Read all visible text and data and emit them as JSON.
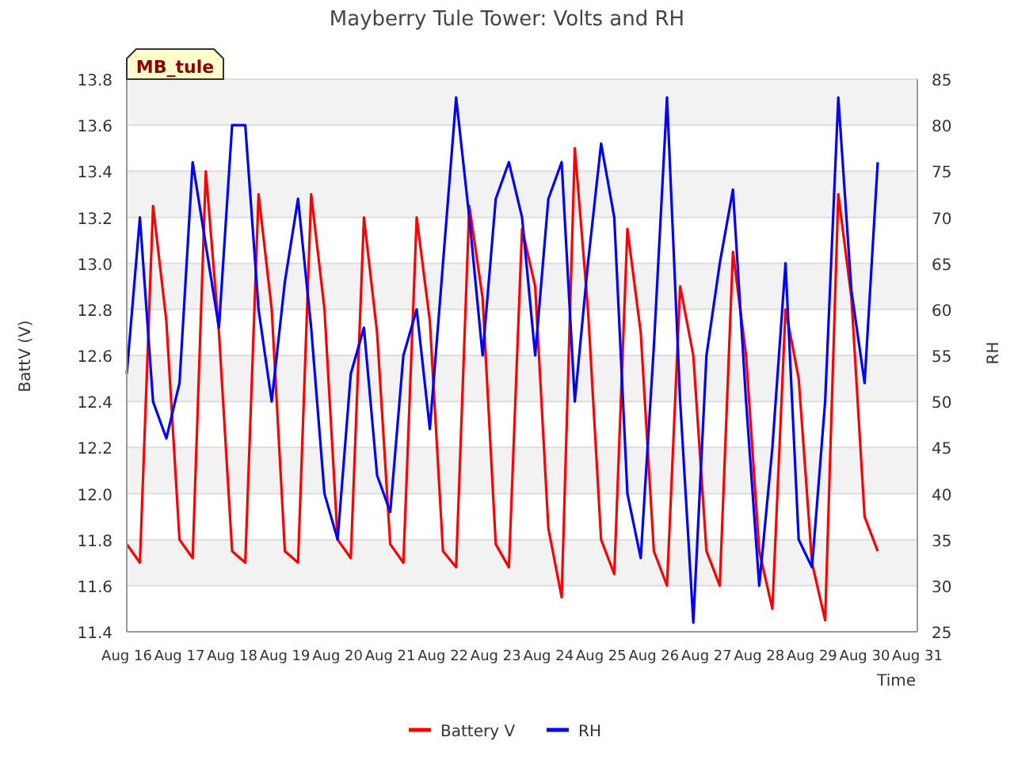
{
  "chart": {
    "tag": "MB_tule",
    "chart_data": {
      "type": "line",
      "title": "Mayberry Tule Tower: Volts and RH",
      "xlabel": "Time",
      "ylabel": "BattV (V)",
      "y2label": "RH",
      "ylim": [
        11.4,
        13.8
      ],
      "y2lim": [
        25,
        85
      ],
      "grid": true,
      "legend": "bottom",
      "yticks": [
        11.4,
        11.6,
        11.8,
        {
          "value": 12,
          "label": "12.0"
        },
        12.2,
        12.4,
        12.6,
        12.8,
        {
          "value": 13,
          "label": "13.0"
        },
        13.2,
        13.4,
        13.6,
        13.8
      ],
      "y2ticks": [
        25,
        30,
        35,
        40,
        45,
        50,
        55,
        60,
        65,
        70,
        75,
        80,
        85
      ],
      "categories": [
        "Aug 16",
        null,
        null,
        null,
        "Aug 17",
        null,
        null,
        null,
        "Aug 18",
        null,
        null,
        null,
        "Aug 19",
        null,
        null,
        null,
        "Aug 20",
        null,
        null,
        null,
        "Aug 21",
        null,
        null,
        null,
        "Aug 22",
        null,
        null,
        null,
        "Aug 23",
        null,
        null,
        null,
        "Aug 24",
        null,
        null,
        null,
        "Aug 25",
        null,
        null,
        null,
        "Aug 26",
        null,
        null,
        null,
        "Aug 27",
        null,
        null,
        null,
        "Aug 28",
        null,
        null,
        null,
        "Aug 29",
        null,
        null,
        null,
        "Aug 30",
        null,
        null,
        null,
        "Aug 31"
      ],
      "series": [
        {
          "name": "Battery V",
          "color": "#ff0000",
          "values": [
            11.78,
            11.7,
            13.25,
            12.75,
            11.8,
            11.72,
            13.4,
            12.7,
            11.75,
            11.7,
            13.3,
            12.8,
            11.75,
            11.7,
            13.3,
            12.8,
            11.8,
            11.72,
            13.2,
            12.7,
            11.78,
            11.7,
            13.2,
            12.75,
            11.75,
            11.68,
            13.25,
            12.85,
            11.78,
            11.68,
            13.15,
            12.9,
            11.85,
            11.55,
            13.5,
            12.8,
            11.8,
            11.65,
            13.15,
            12.7,
            11.75,
            11.6,
            12.9,
            12.6,
            11.75,
            11.6,
            13.05,
            12.6,
            11.75,
            11.5,
            12.8,
            12.5,
            11.7,
            11.45,
            13.3,
            12.85,
            11.9,
            11.75,
            null,
            null,
            null
          ]
        },
        {
          "name": "RH",
          "color": "#0000ff",
          "axis": "y2",
          "values": [
            53,
            70,
            50,
            46,
            52,
            76,
            67,
            58,
            80,
            80,
            60,
            50,
            63,
            72,
            58,
            40,
            35,
            53,
            58,
            42,
            38,
            55,
            60,
            47,
            65,
            83,
            70,
            55,
            72,
            76,
            70,
            55,
            72,
            76,
            50,
            65,
            78,
            70,
            40,
            33,
            56,
            83,
            50,
            26,
            55,
            65,
            73,
            50,
            30,
            45,
            65,
            35,
            32,
            50,
            83,
            62,
            52,
            76,
            null,
            null,
            null
          ]
        }
      ]
    }
  }
}
